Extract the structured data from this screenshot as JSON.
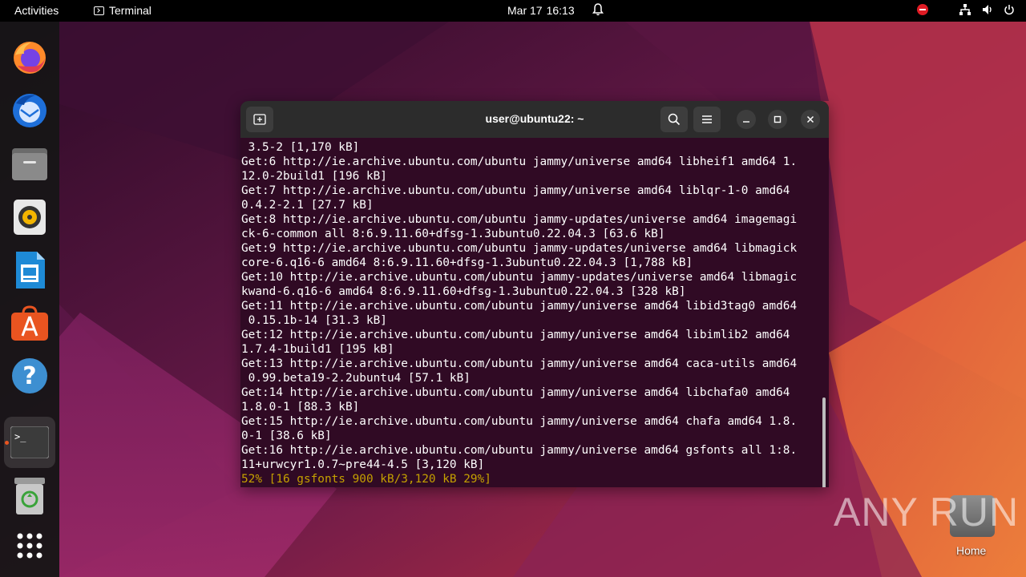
{
  "topbar": {
    "activities": "Activities",
    "app_name": "Terminal",
    "date": "Mar 17",
    "time": "16:13"
  },
  "dock": {
    "items": [
      "firefox-icon",
      "thunderbird-icon",
      "files-icon",
      "rhythmbox-icon",
      "libreoffice-writer-icon",
      "app-center-icon",
      "help-icon",
      "terminal-icon",
      "trash-icon",
      "show-apps-icon"
    ]
  },
  "window": {
    "title": "user@ubuntu22: ~",
    "lines": [
      " 3.5-2 [1,170 kB]",
      "Get:6 http://ie.archive.ubuntu.com/ubuntu jammy/universe amd64 libheif1 amd64 1.",
      "12.0-2build1 [196 kB]",
      "Get:7 http://ie.archive.ubuntu.com/ubuntu jammy/universe amd64 liblqr-1-0 amd64",
      "0.4.2-2.1 [27.7 kB]",
      "Get:8 http://ie.archive.ubuntu.com/ubuntu jammy-updates/universe amd64 imagemagi",
      "ck-6-common all 8:6.9.11.60+dfsg-1.3ubuntu0.22.04.3 [63.6 kB]",
      "Get:9 http://ie.archive.ubuntu.com/ubuntu jammy-updates/universe amd64 libmagick",
      "core-6.q16-6 amd64 8:6.9.11.60+dfsg-1.3ubuntu0.22.04.3 [1,788 kB]",
      "Get:10 http://ie.archive.ubuntu.com/ubuntu jammy-updates/universe amd64 libmagic",
      "kwand-6.q16-6 amd64 8:6.9.11.60+dfsg-1.3ubuntu0.22.04.3 [328 kB]",
      "Get:11 http://ie.archive.ubuntu.com/ubuntu jammy/universe amd64 libid3tag0 amd64",
      " 0.15.1b-14 [31.3 kB]",
      "Get:12 http://ie.archive.ubuntu.com/ubuntu jammy/universe amd64 libimlib2 amd64",
      "1.7.4-1build1 [195 kB]",
      "Get:13 http://ie.archive.ubuntu.com/ubuntu jammy/universe amd64 caca-utils amd64",
      " 0.99.beta19-2.2ubuntu4 [57.1 kB]",
      "Get:14 http://ie.archive.ubuntu.com/ubuntu jammy/universe amd64 libchafa0 amd64",
      "1.8.0-1 [88.3 kB]",
      "Get:15 http://ie.archive.ubuntu.com/ubuntu jammy/universe amd64 chafa amd64 1.8.",
      "0-1 [38.6 kB]",
      "Get:16 http://ie.archive.ubuntu.com/ubuntu jammy/universe amd64 gsfonts all 1:8.",
      "11+urwcyr1.0.7~pre44-4.5 [3,120 kB]"
    ],
    "progress_line": "52% [16 gsfonts 900 kB/3,120 kB 29%]"
  },
  "desktop": {
    "watermark": "ANY RUN",
    "home_label": "Home"
  },
  "colors": {
    "terminal_bg": "#300a24",
    "progress_text": "#c4a000",
    "accent": "#e95420"
  }
}
